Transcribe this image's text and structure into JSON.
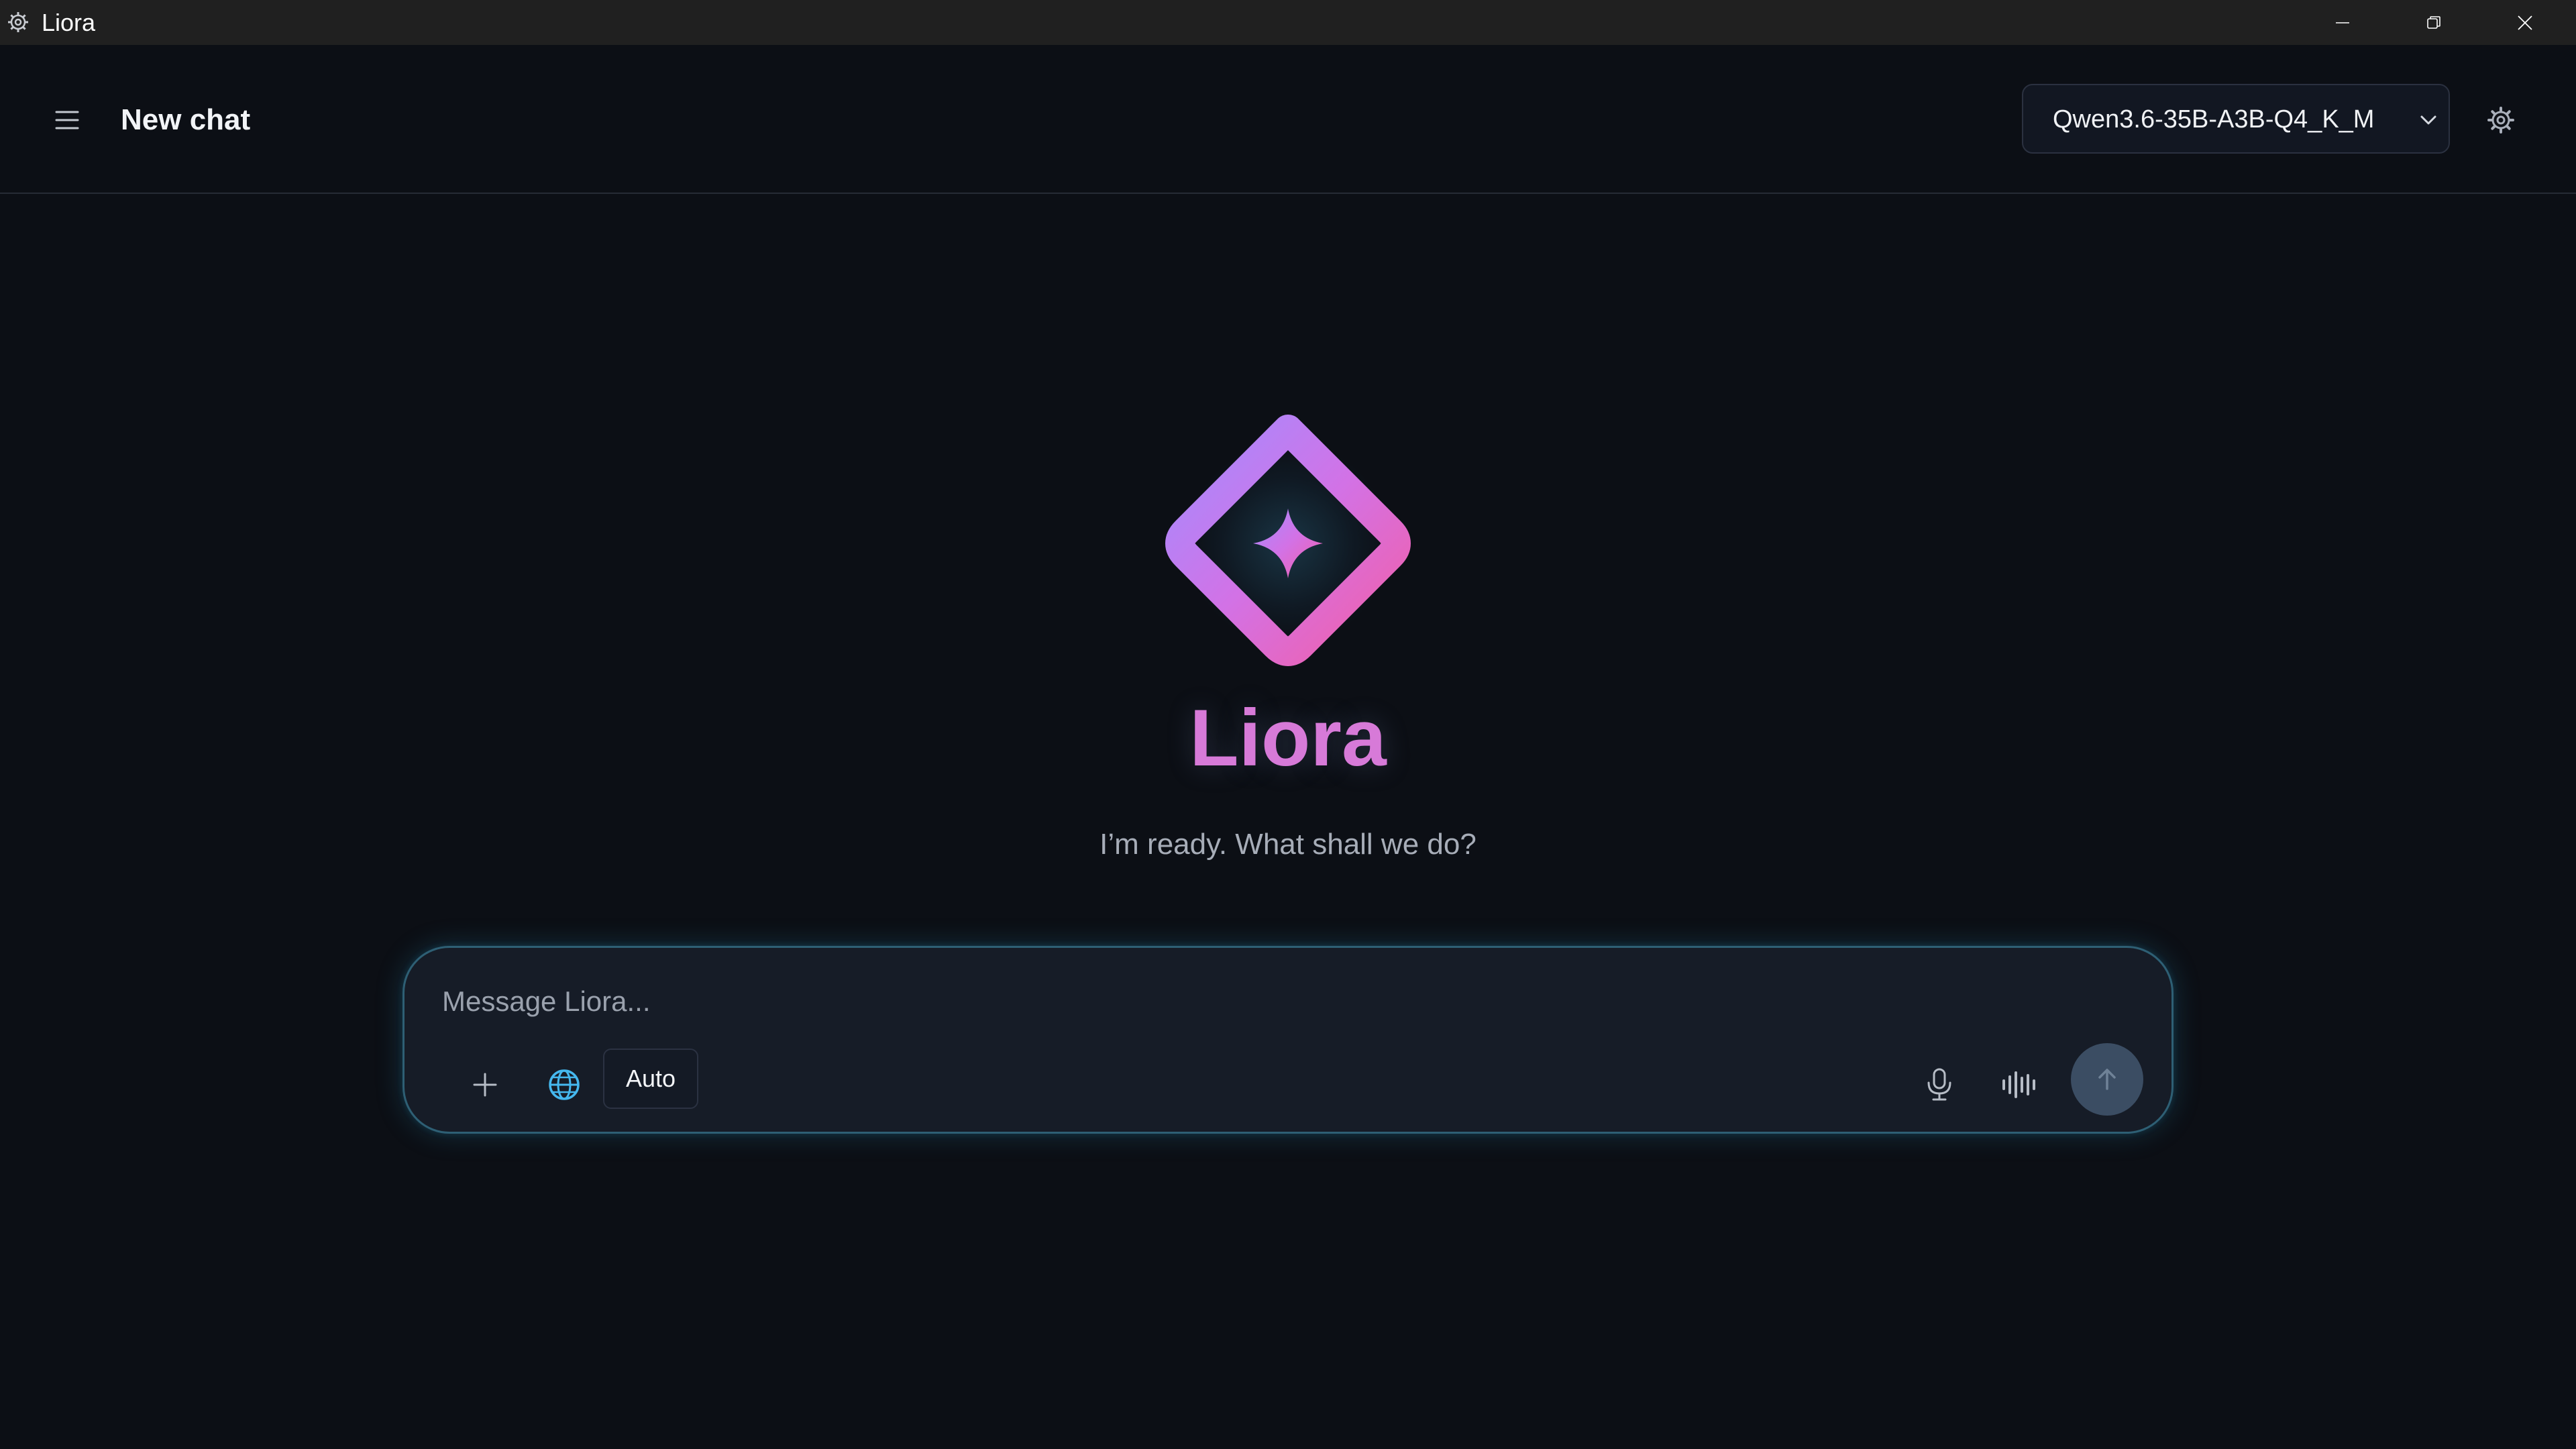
{
  "window": {
    "title": "Liora",
    "icon": "app-gear-icon",
    "controls": [
      "minimize-icon",
      "restore-icon",
      "close-icon"
    ]
  },
  "header": {
    "menu_icon": "hamburger-menu-icon",
    "chat_title": "New chat",
    "model_select": {
      "selected": "Qwen3.6-35B-A3B-Q4_K_M",
      "icon": "chevron-down-icon"
    },
    "settings_icon": "gear-icon"
  },
  "hero": {
    "logo": "diamond-sparkle-logo",
    "brand_name": "Liora",
    "tagline": "I’m ready. What shall we do?"
  },
  "composer": {
    "placeholder": "Message Liora...",
    "value": "",
    "attach_icon": "plus-icon",
    "web_icon": "globe-icon",
    "mode_label": "Auto",
    "mic_icon": "microphone-icon",
    "voice_icon": "waveform-icon",
    "send_icon": "arrow-up-icon"
  },
  "colors": {
    "background": "#0c0f15",
    "titlebar": "#202020",
    "brand_gradient_start": "#a48cff",
    "brand_gradient_end": "#f25fa8",
    "brand_text": "#d77ad8",
    "composer_border": "#2e5f74",
    "globe_accent": "#45b8ef",
    "send_button": "#3b4d63"
  }
}
